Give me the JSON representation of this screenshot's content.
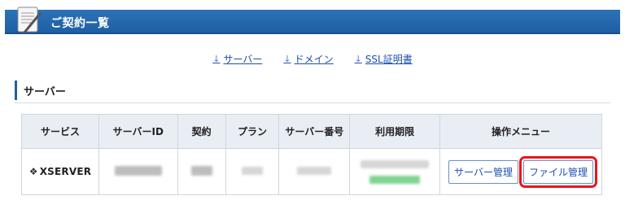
{
  "header": {
    "title": "ご契約一覧",
    "icon": "contract-document-icon"
  },
  "anchor_nav": [
    {
      "label": "サーバー",
      "icon": "arrow-down-icon"
    },
    {
      "label": "ドメイン",
      "icon": "arrow-down-icon"
    },
    {
      "label": "SSL証明書",
      "icon": "arrow-down-icon"
    }
  ],
  "section": {
    "title": "サーバー"
  },
  "table": {
    "columns": [
      "サービス",
      "サーバーID",
      "契約",
      "プラン",
      "サーバー番号",
      "利用期限",
      "操作メニュー"
    ],
    "rows": [
      {
        "service": "XSERVER",
        "service_icon": "xserver-logo-icon",
        "server_manage_label": "サーバー管理",
        "file_manage_label": "ファイル管理"
      }
    ]
  },
  "colors": {
    "header_bg": "#2068b0",
    "link": "#1a4fb3",
    "highlight": "#e8161c",
    "table_header_bg": "#e9eef4"
  }
}
